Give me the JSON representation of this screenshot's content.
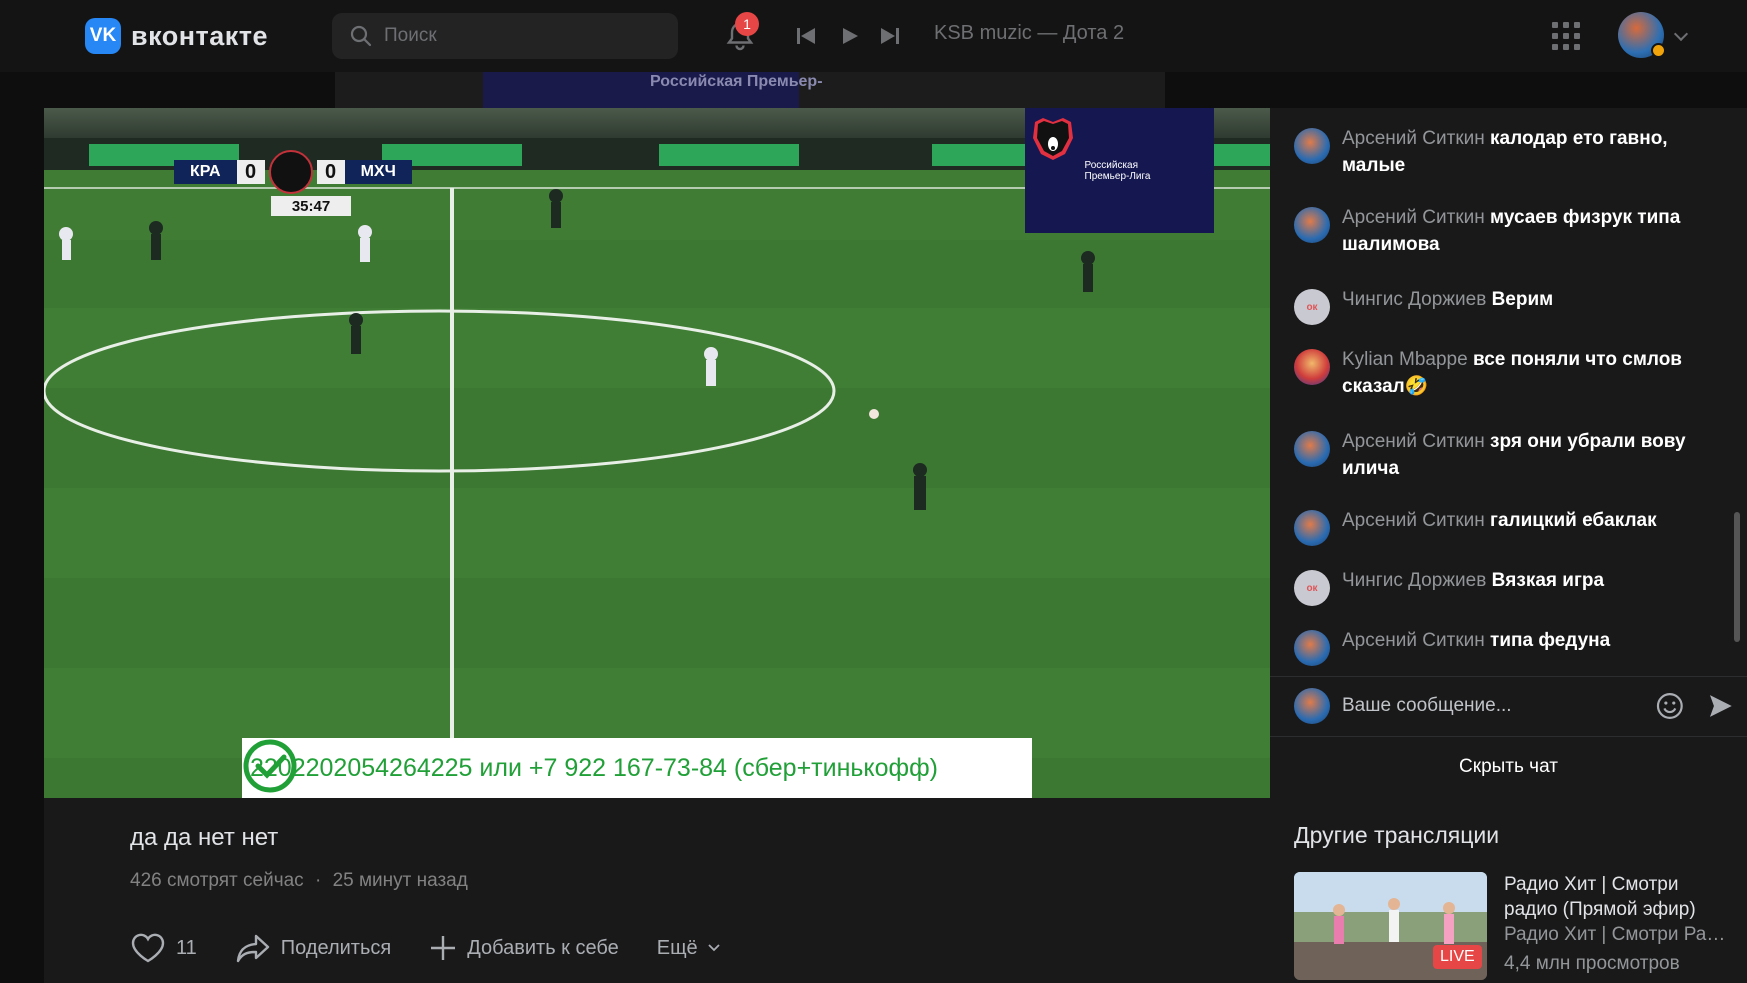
{
  "header": {
    "logo_mark": "VK",
    "logo_text": "вконтакте",
    "search_placeholder": "Поиск",
    "notifications_count": "1",
    "now_playing": "KSB muzic — Дота 2"
  },
  "broadcast": {
    "backdrop_text": "Российская Премьер-",
    "scoreboard": {
      "home": "КРА",
      "home_score": "0",
      "away_score": "0",
      "away": "МХЧ",
      "time": "35:47"
    },
    "league_badge": "Российская Премьер-Лига",
    "donate_text": "2202202054264225 или +7 922 167-73-84 (сбер+тинькофф)"
  },
  "stream": {
    "title": "да да нет нет",
    "viewers": "426 смотрят сейчас",
    "separator": "·",
    "started": "25 минут назад",
    "likes": "11",
    "share_label": "Поделиться",
    "add_label": "Добавить к себе",
    "more_label": "Ещё"
  },
  "chat": {
    "messages": [
      {
        "author": "Арсений Ситкин",
        "text": "калодар ето гавно, малые"
      },
      {
        "author": "Арсений Ситкин",
        "text": "мусаев физрук типа шалимова"
      },
      {
        "author": "Чингис Доржиев",
        "text": "Верим"
      },
      {
        "author": "Kylian Mbappe",
        "text": "все поняли что смлов сказал🤣"
      },
      {
        "author": "Арсений Ситкин",
        "text": "зря они убрали вову илича"
      },
      {
        "author": "Арсений Ситкин",
        "text": "галицкий ебаклак"
      },
      {
        "author": "Чингис Доржиев",
        "text": "Вязкая игра"
      },
      {
        "author": "Арсений Ситкин",
        "text": "типа федуна"
      }
    ],
    "ok_badge": "ок",
    "input_placeholder": "Ваше сообщение...",
    "hide_label": "Скрыть чат"
  },
  "other": {
    "heading": "Другие трансляции",
    "items": [
      {
        "title": "Радио Хит | Смотри радио (Прямой эфир)",
        "channel": "Радио Хит | Смотри Радио Хит",
        "views": "4,4 млн просмотров",
        "badge": "LIVE"
      }
    ]
  }
}
